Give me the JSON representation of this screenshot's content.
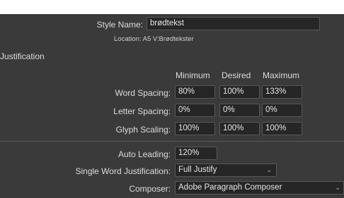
{
  "style_name": {
    "label": "Style Name:",
    "value": "brødtekst"
  },
  "location": {
    "text": "Location:  A5 V:Brødtekster"
  },
  "section": {
    "title": "Justification"
  },
  "columns": {
    "minimum": "Minimum",
    "desired": "Desired",
    "maximum": "Maximum"
  },
  "rows": [
    {
      "label": "Word Spacing:",
      "min": "80%",
      "des": "100%",
      "max": "133%"
    },
    {
      "label": "Letter Spacing:",
      "min": "0%",
      "des": "0%",
      "max": "0%"
    },
    {
      "label": "Glyph Scaling:",
      "min": "100%",
      "des": "100%",
      "max": "100%"
    }
  ],
  "auto_leading": {
    "label": "Auto Leading:",
    "value": "120%"
  },
  "single_word": {
    "label": "Single Word Justification:",
    "value": "Full Justify",
    "icon": "chevron-down-icon"
  },
  "composer": {
    "label": "Composer:",
    "value": "Adobe Paragraph Composer",
    "icon": "chevron-down-icon"
  }
}
